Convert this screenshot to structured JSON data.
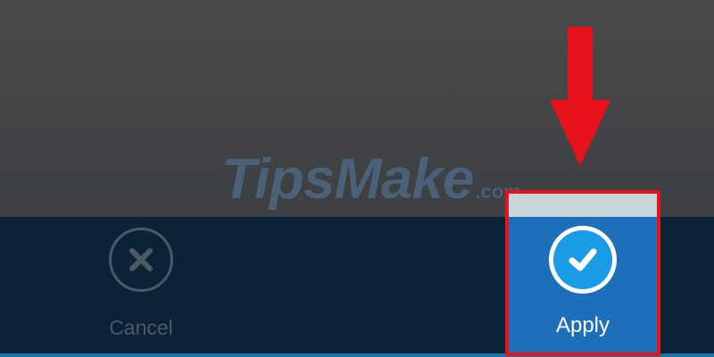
{
  "watermark": {
    "main": "TipsMake",
    "suffix": ".com"
  },
  "actions": {
    "cancel_label": "Cancel",
    "apply_label": "Apply"
  },
  "icons": {
    "cancel": "close-icon",
    "apply": "checkmark-icon",
    "annotation": "arrow-down-icon"
  },
  "colors": {
    "top_background": "#434547",
    "bottom_bar": "#0c2236",
    "apply_tile": "#1c6fb8",
    "apply_icon": "#1a9be6",
    "highlight": "#e8121a",
    "disabled_text": "#4d5a66",
    "bottom_strip": "#1378a8"
  }
}
